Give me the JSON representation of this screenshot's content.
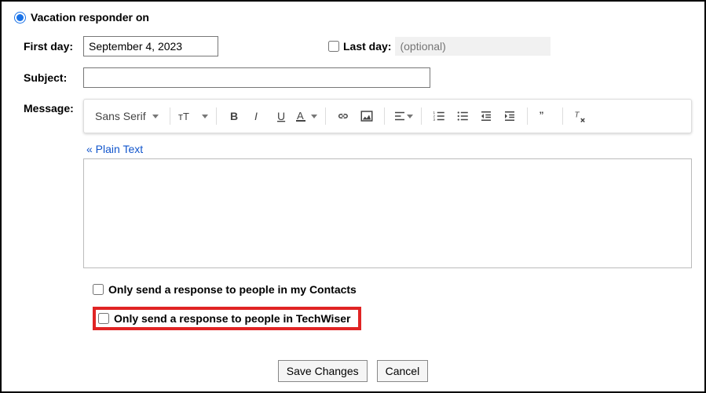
{
  "responder": {
    "on_label": "Vacation responder on",
    "first_day_label": "First day:",
    "first_day_value": "September 4, 2023",
    "last_day_label": "Last day:",
    "last_day_placeholder": "(optional)",
    "subject_label": "Subject:",
    "subject_value": "",
    "message_label": "Message:",
    "message_value": ""
  },
  "toolbar": {
    "font_label": "Sans Serif"
  },
  "plain_text_label": "« Plain Text",
  "options": {
    "contacts_label": "Only send a response to people in my Contacts",
    "org_label": "Only send a response to people in TechWiser"
  },
  "footer": {
    "save_label": "Save Changes",
    "cancel_label": "Cancel"
  }
}
